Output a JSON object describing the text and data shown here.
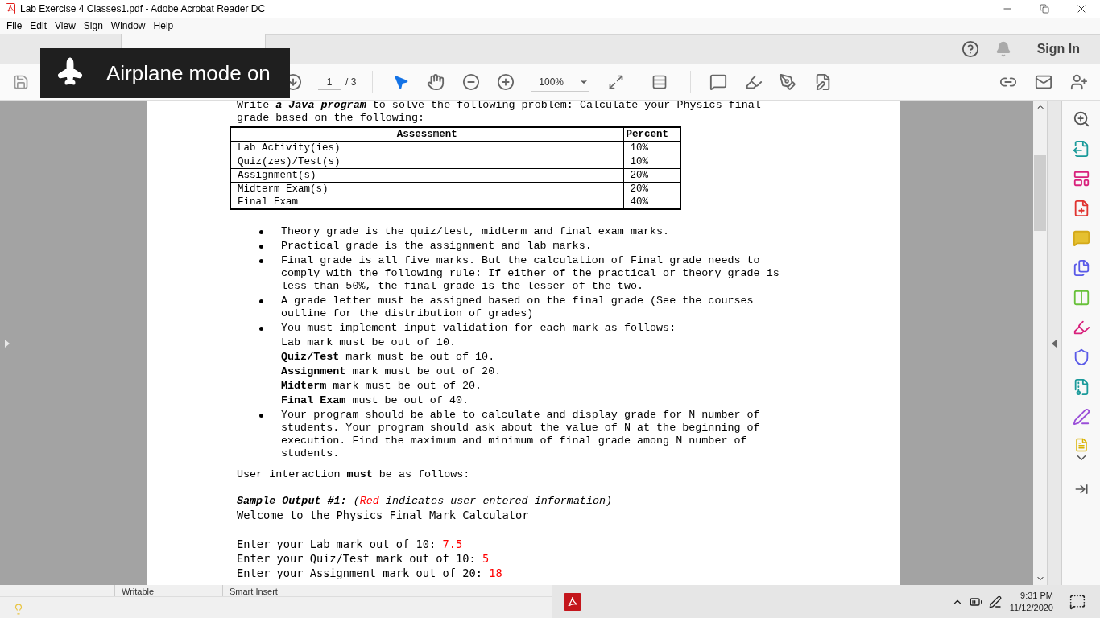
{
  "window": {
    "title": "Lab Exercise 4 Classes1.pdf - Adobe Acrobat Reader DC"
  },
  "menu": [
    "File",
    "Edit",
    "View",
    "Sign",
    "Window",
    "Help"
  ],
  "tabs": [
    {
      "selected": false
    },
    {
      "selected": false
    },
    {
      "selected": true
    }
  ],
  "sign_in": "Sign In",
  "toolbar": {
    "page": "1",
    "page_total": "/ 3",
    "zoom": "100%"
  },
  "toast": {
    "text": "Airplane mode on"
  },
  "document": {
    "intro": "Write *a Java program* to solve the following problem:  Calculate your Physics final grade based on the following:",
    "table": {
      "columns": [
        "Assessment",
        "Percent"
      ],
      "rows": [
        [
          "Lab Activity(ies)",
          "10%"
        ],
        [
          "Quiz(zes)/Test(s)",
          "10%"
        ],
        [
          "Assignment(s)",
          "20%"
        ],
        [
          "Midterm Exam(s)",
          "20%"
        ],
        [
          "Final Exam",
          "40%"
        ]
      ]
    },
    "bullets": [
      {
        "text": "Theory grade is the quiz/test, midterm and final exam marks."
      },
      {
        "text": "Practical grade is the assignment and lab marks."
      },
      {
        "text": "Final grade is all five marks. But the calculation of Final grade needs to comply with the following rule: If either of the practical or theory grade is less than 50%, the final grade is the lesser of the two."
      },
      {
        "text": "A grade letter must be assigned based on the final grade (See the courses outline for the distribution of grades)"
      },
      {
        "text": "You must implement input validation for each mark as follows:",
        "rules": [
          "Lab mark must be out of 10.",
          "**Quiz/Test** mark must be out of 10.",
          "**Assignment** mark must be out of 20.",
          "**Midterm** mark must be out of 20.",
          "**Final Exam** must be out of 40."
        ]
      },
      {
        "text": "Your program should be able to calculate and display grade for N number of students. Your program should ask about the value of N at the beginning of execution. Find the maximum and minimum of final grade among N number of students."
      }
    ],
    "interaction": "User interaction **must** be as follows:",
    "sample_heading": "Sample Output #1:",
    "sample_note": [
      {
        "text": "(",
        "kind": "plain"
      },
      {
        "text": "Red",
        "kind": "input"
      },
      {
        "text": " indicates user entered information)",
        "kind": "plain"
      }
    ],
    "welcome": "Welcome to the Physics Final Mark Calculator",
    "prompts": [
      {
        "prompt": "Enter your Lab mark out of 10:",
        "answer": "7.5"
      },
      {
        "prompt": "Enter your Quiz/Test mark out of 10:",
        "answer": "5"
      },
      {
        "prompt": "Enter your Assignment mark out of 20:",
        "answer": "18"
      }
    ]
  },
  "status_bar": [
    "Writable",
    "Smart Insert"
  ],
  "taskbar": {
    "time": "9:31 PM",
    "date": "11/12/2020"
  }
}
